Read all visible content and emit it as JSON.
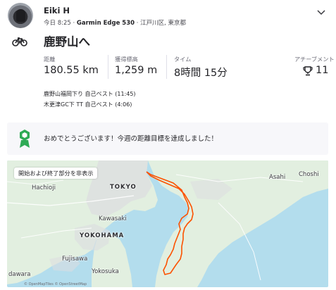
{
  "header": {
    "athlete_name": "Eiki H",
    "time": "今日 8:25",
    "device": "Garmin Edge 530",
    "location": "江戸川区, 東京都",
    "separator": "·"
  },
  "activity": {
    "type_icon": "bike-icon",
    "title": "鹿野山へ"
  },
  "stats": [
    {
      "label": "距離",
      "value": "180.55 km"
    },
    {
      "label": "獲得標高",
      "value": "1,259 m"
    },
    {
      "label": "タイム",
      "value": "8時間 15分"
    }
  ],
  "achievements": {
    "label": "アチーブメント",
    "count": "11",
    "icon": "trophy-icon"
  },
  "segments": [
    {
      "name": "鹿野山福岡下り",
      "result": "自己ベスト (11:45)"
    },
    {
      "name": "木更津GC下",
      "result": "TT 自己ベスト (4:06)"
    }
  ],
  "banner": {
    "icon": "goal-medal-icon",
    "text": "おめでとうございます！今週の距離目標を達成しました！"
  },
  "map": {
    "toggle_label": "開始および終了部分を非表示",
    "places": [
      "Hachioji",
      "TOKYO",
      "Asahi",
      "Choshi",
      "Kawasaki",
      "YOKOHAMA",
      "Fujisawa",
      "Yokosuka",
      "dawara"
    ],
    "attribution": "© OpenMapTiles © OpenStreetMap"
  },
  "colors": {
    "route": "#fc5200",
    "water": "#b3dded",
    "land": "#e2efe0",
    "brand_green": "#2eaa55"
  }
}
